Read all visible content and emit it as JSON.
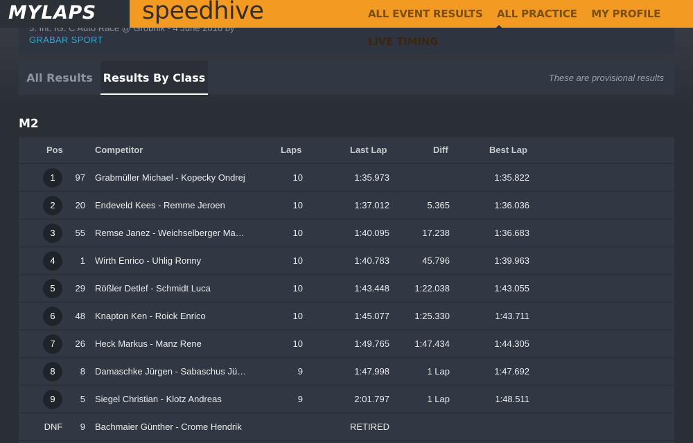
{
  "header": {
    "logo": "MYLAPS",
    "brand": "speedhive",
    "nav": [
      "ALL EVENT RESULTS",
      "ALL PRACTICE",
      "MY PROFILE",
      "LIVE TIMING"
    ]
  },
  "event": {
    "subtitle": "5. Int. IG. C Auto Race @ Grobnik - 4 June 2016 by",
    "organizer": "GRABAR SPORT"
  },
  "tabs": {
    "all": "All Results",
    "by_class": "Results By Class"
  },
  "notice": "These are provisional results",
  "class_name": "M2",
  "table": {
    "headers": {
      "pos": "Pos",
      "competitor": "Competitor",
      "laps": "Laps",
      "last": "Last Lap",
      "diff": "Diff",
      "best": "Best Lap"
    },
    "rows": [
      {
        "pos": "1",
        "num": "97",
        "name": "Grabmüller Michael - Kopecky Ondrej",
        "laps": "10",
        "last": "1:35.973",
        "diff": "",
        "best": "1:35.822"
      },
      {
        "pos": "2",
        "num": "20",
        "name": "Endeveld Kees - Remme Jeroen",
        "laps": "10",
        "last": "1:37.012",
        "diff": "5.365",
        "best": "1:36.036"
      },
      {
        "pos": "3",
        "num": "55",
        "name": "Remse Janez - Weichselberger Ma…",
        "laps": "10",
        "last": "1:40.095",
        "diff": "17.238",
        "best": "1:36.683"
      },
      {
        "pos": "4",
        "num": "1",
        "name": "Wirth Enrico - Uhlig Ronny",
        "laps": "10",
        "last": "1:40.783",
        "diff": "45.796",
        "best": "1:39.963"
      },
      {
        "pos": "5",
        "num": "29",
        "name": "Rößler Detlef - Schmidt Luca",
        "laps": "10",
        "last": "1:43.448",
        "diff": "1:22.038",
        "best": "1:43.055"
      },
      {
        "pos": "6",
        "num": "48",
        "name": "Knapton Ken - Roick Enrico",
        "laps": "10",
        "last": "1:45.077",
        "diff": "1:25.330",
        "best": "1:43.711"
      },
      {
        "pos": "7",
        "num": "26",
        "name": "Heck Markus - Manz Rene",
        "laps": "10",
        "last": "1:49.765",
        "diff": "1:47.434",
        "best": "1:44.305"
      },
      {
        "pos": "8",
        "num": "8",
        "name": "Damaschke Jürgen - Sabaschus Jü…",
        "laps": "9",
        "last": "1:47.998",
        "diff": "1 Lap",
        "best": "1:47.692"
      },
      {
        "pos": "9",
        "num": "5",
        "name": "Siegel Christian - Klotz Andreas",
        "laps": "9",
        "last": "2:01.797",
        "diff": "1 Lap",
        "best": "1:48.511"
      },
      {
        "pos": "DNF",
        "num": "9",
        "name": "Bachmaier Günther - Crome Hendrik",
        "laps": "",
        "last": "RETIRED",
        "diff": "",
        "best": ""
      }
    ]
  },
  "colors": {
    "accent": "#f39a22",
    "link": "#2aa8d0",
    "background": "#2a2e35",
    "panel": "#323843"
  }
}
